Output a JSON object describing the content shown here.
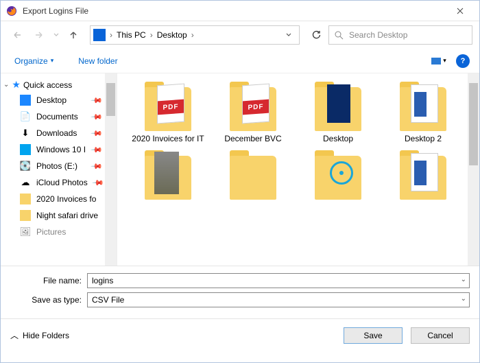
{
  "window": {
    "title": "Export Logins File"
  },
  "breadcrumb": {
    "root": "This PC",
    "current": "Desktop"
  },
  "search": {
    "placeholder": "Search Desktop"
  },
  "toolbar": {
    "organize": "Organize",
    "new_folder": "New folder"
  },
  "quick_access": {
    "label": "Quick access"
  },
  "sidebar": {
    "items": [
      {
        "label": "Desktop",
        "pinned": true,
        "icon": "desktop"
      },
      {
        "label": "Documents",
        "pinned": true,
        "icon": "folder"
      },
      {
        "label": "Downloads",
        "pinned": true,
        "icon": "folder"
      },
      {
        "label": "Windows 10 I",
        "pinned": true,
        "icon": "win"
      },
      {
        "label": "Photos (E:)",
        "pinned": true,
        "icon": "drive"
      },
      {
        "label": "iCloud Photos",
        "pinned": true,
        "icon": "icloud"
      },
      {
        "label": "2020 Invoices fo",
        "pinned": false,
        "icon": "folder"
      },
      {
        "label": "Night safari drive",
        "pinned": false,
        "icon": "folder"
      },
      {
        "label": "Pictures",
        "pinned": false,
        "icon": "pictures"
      }
    ]
  },
  "items": [
    {
      "label": "2020 Invoices for IT",
      "kind": "pdf-folder"
    },
    {
      "label": "December BVC",
      "kind": "pdf-folder"
    },
    {
      "label": "Desktop",
      "kind": "blue-folder"
    },
    {
      "label": "Desktop 2",
      "kind": "word-folder"
    },
    {
      "label": "",
      "kind": "image-folder"
    },
    {
      "label": "",
      "kind": "plain-folder"
    },
    {
      "label": "",
      "kind": "circle-folder"
    },
    {
      "label": "",
      "kind": "word-folder"
    }
  ],
  "form": {
    "file_name_label": "File name:",
    "file_name_value": "logins",
    "type_label": "Save as type:",
    "type_value": "CSV File"
  },
  "footer": {
    "hide_folders": "Hide Folders",
    "save": "Save",
    "cancel": "Cancel"
  }
}
